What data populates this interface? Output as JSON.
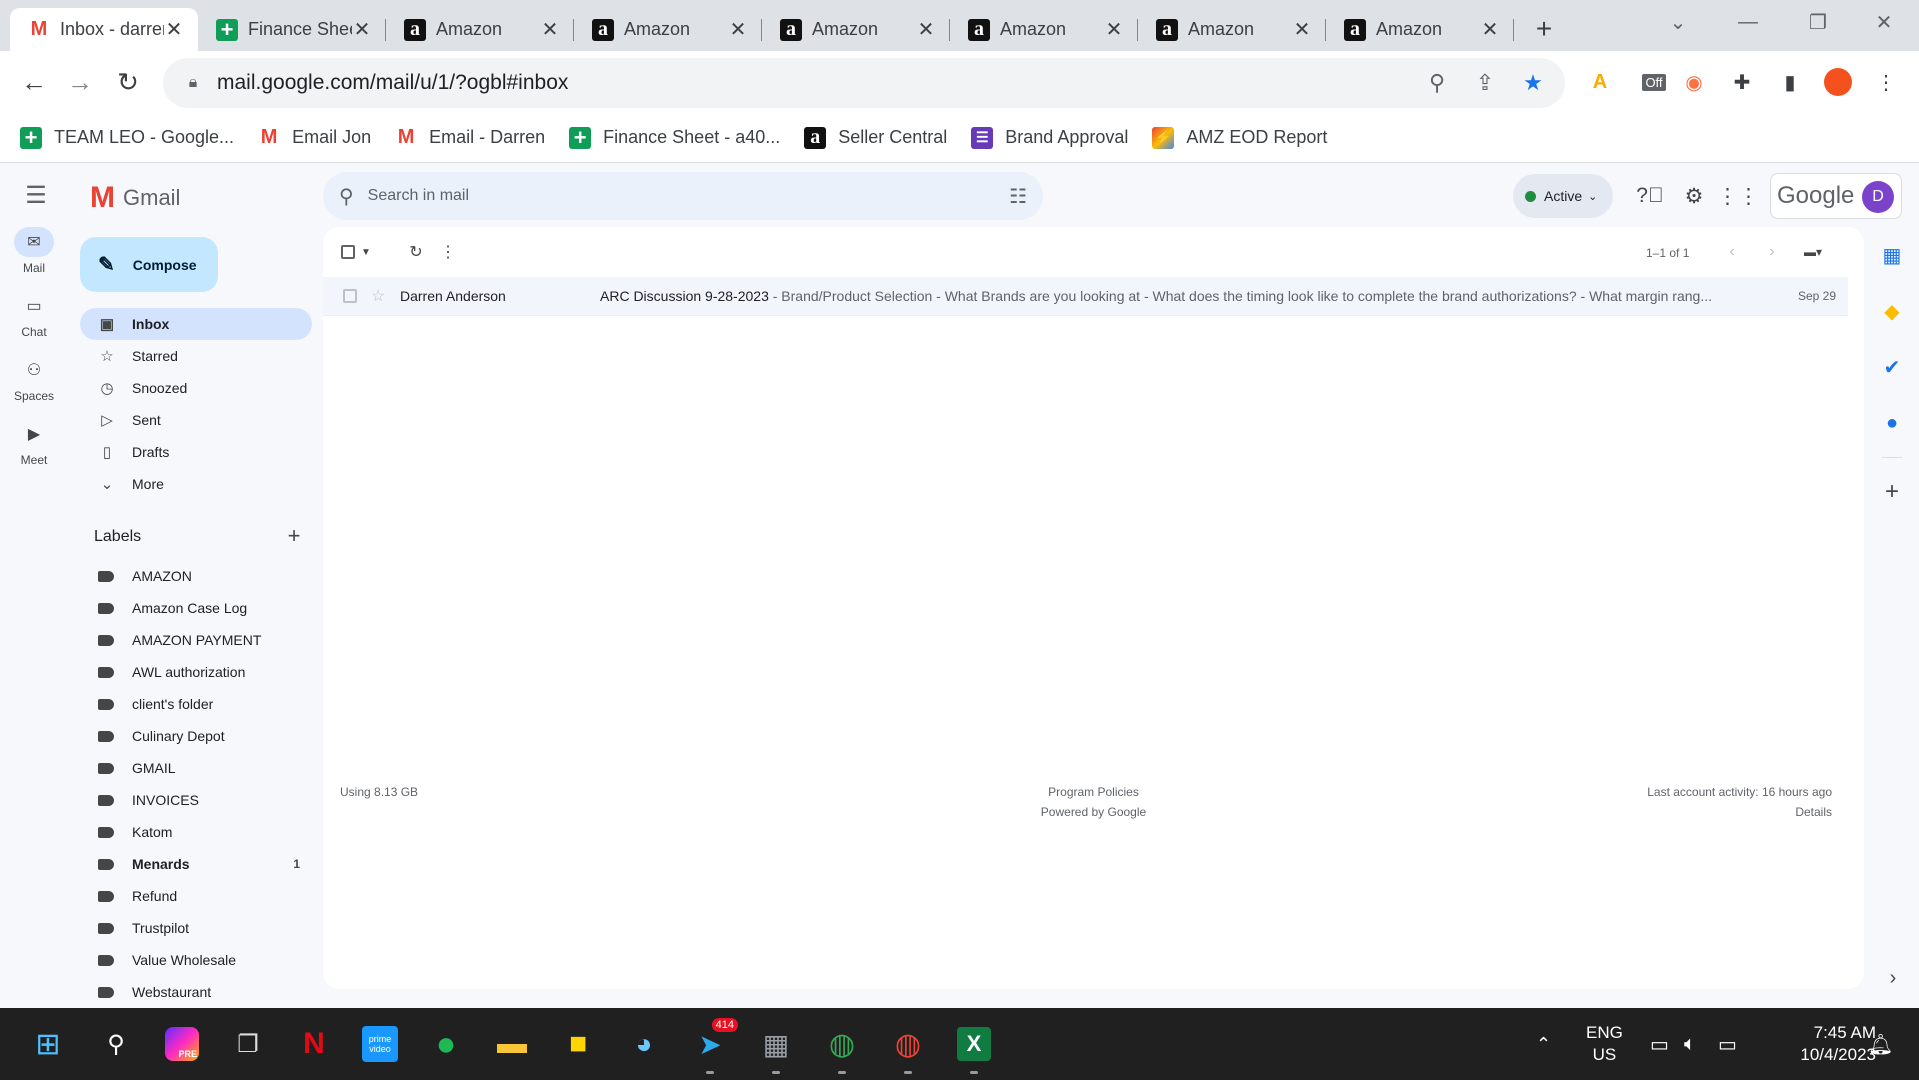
{
  "browser": {
    "tabs": [
      {
        "title": "Inbox - darren",
        "icon": "gmail-icon",
        "active": true
      },
      {
        "title": "Finance Sheet",
        "icon": "sheets-icon"
      },
      {
        "title": "Amazon",
        "icon": "amazon-icon"
      },
      {
        "title": "Amazon",
        "icon": "amazon-icon"
      },
      {
        "title": "Amazon",
        "icon": "amazon-icon"
      },
      {
        "title": "Amazon",
        "icon": "amazon-icon"
      },
      {
        "title": "Amazon",
        "icon": "amazon-icon"
      },
      {
        "title": "Amazon",
        "icon": "amazon-icon"
      }
    ],
    "close_glyph": "✕",
    "new_tab_glyph": "+",
    "url": "mail.google.com/mail/u/1/?ogbl#inbox",
    "extension_off_label": "Off",
    "bookmarks": [
      {
        "label": "TEAM LEO - Google...",
        "icon": "sheets-icon"
      },
      {
        "label": "Email Jon",
        "icon": "gmail-icon"
      },
      {
        "label": "Email - Darren",
        "icon": "gmail-icon"
      },
      {
        "label": "Finance Sheet - a40...",
        "icon": "sheets-icon"
      },
      {
        "label": "Seller Central",
        "icon": "amazon-icon"
      },
      {
        "label": "Brand Approval",
        "icon": "forms-icon"
      },
      {
        "label": "AMZ EOD Report",
        "icon": "report-icon"
      }
    ]
  },
  "gmail": {
    "app_name": "Gmail",
    "search_placeholder": "Search in mail",
    "status": "Active",
    "brand": "Google",
    "avatar_letter": "D",
    "rail": [
      {
        "label": "Mail",
        "icon": "mail-icon",
        "selected": true
      },
      {
        "label": "Chat",
        "icon": "chat-icon"
      },
      {
        "label": "Spaces",
        "icon": "spaces-icon"
      },
      {
        "label": "Meet",
        "icon": "meet-icon"
      }
    ],
    "compose_label": "Compose",
    "folders": [
      {
        "label": "Inbox",
        "icon": "inbox-icon",
        "selected": true
      },
      {
        "label": "Starred",
        "icon": "star-icon"
      },
      {
        "label": "Snoozed",
        "icon": "clock-icon"
      },
      {
        "label": "Sent",
        "icon": "send-icon"
      },
      {
        "label": "Drafts",
        "icon": "draft-icon"
      },
      {
        "label": "More",
        "icon": "chevron-down-icon"
      }
    ],
    "labels_heading": "Labels",
    "labels": [
      {
        "label": "AMAZON"
      },
      {
        "label": "Amazon Case Log"
      },
      {
        "label": "AMAZON PAYMENT"
      },
      {
        "label": "AWL authorization"
      },
      {
        "label": "client's folder"
      },
      {
        "label": "Culinary Depot"
      },
      {
        "label": "GMAIL"
      },
      {
        "label": "INVOICES"
      },
      {
        "label": "Katom"
      },
      {
        "label": "Menards",
        "count": "1",
        "bold": true
      },
      {
        "label": "Refund"
      },
      {
        "label": "Trustpilot"
      },
      {
        "label": "Value Wholesale"
      },
      {
        "label": "Webstaurant"
      }
    ],
    "pager": "1–1 of 1",
    "emails": [
      {
        "sender": "Darren Anderson",
        "subject": "ARC Discussion 9-28-2023",
        "snippet": " - Brand/Product Selection - What Brands are you looking at - What does the timing look like to complete the brand authorizations? - What margin rang...",
        "date": "Sep 29"
      }
    ],
    "footer": {
      "storage": "Using 8.13 GB",
      "policies": "Program Policies",
      "powered": "Powered by Google",
      "activity": "Last account activity: 16 hours ago",
      "details": "Details"
    }
  },
  "taskbar": {
    "telegram_badge": "414",
    "language": "ENG",
    "region": "US",
    "time": "7:45 AM",
    "date": "10/4/2023",
    "prime_label": "prime video",
    "photoshop_label": "PRE"
  },
  "colors": {
    "gmail_red": "#ea4335",
    "compose_bg": "#c2e7ff",
    "selected_bg": "#d3e3fd",
    "active_dot": "#1e8e3e",
    "bookmark_star": "#1a73e8"
  }
}
